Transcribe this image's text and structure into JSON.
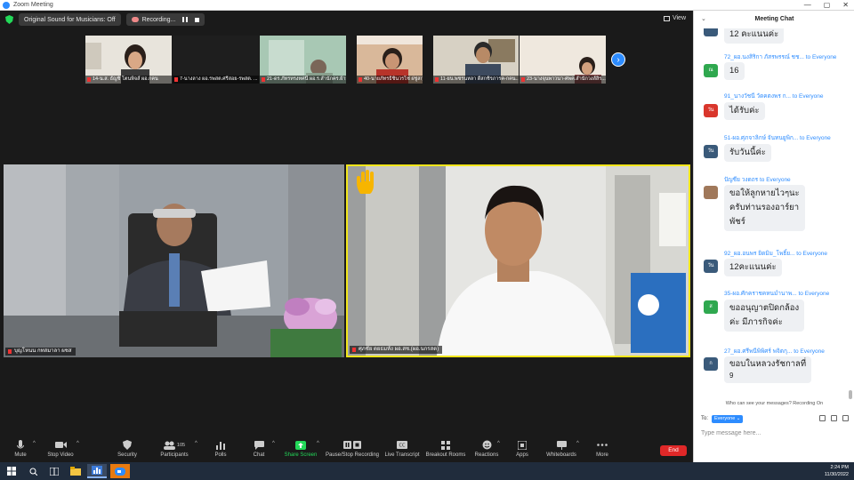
{
  "window": {
    "title": "Zoom Meeting",
    "controls": [
      "—",
      "▢",
      "✕"
    ]
  },
  "topbar": {
    "original_sound": "Original Sound for Musicians: Off",
    "recording": "Recording...",
    "view": "View"
  },
  "thumbnails": [
    {
      "label": "14-น.ส. ธัญชิ โตนพิจส์ ผอ.กคน"
    },
    {
      "label": "7-นางลาง ผอ.รพสต.ศรีสอย-รพสต. ..."
    },
    {
      "label": "21-ดร.ภัทรทรงทศนี้ ผอ.ร.สำนักคร.ฝ้าย..."
    },
    {
      "label": "40-นายภัทรธิชินวรโซ่ ฝชู่สกุลชุธ..."
    },
    {
      "label": "11-ยน.พชรนหลา ดีสกชิรภารค-กคน..."
    },
    {
      "label": "23-นางจุนพาวนา-ศพค.สำนักวงส์สิร..."
    }
  ],
  "main_tiles": [
    {
      "label": "บุญโหนน กทสมาลา ผชส"
    },
    {
      "label": "ศุภชัย ตยธมหัง ผอ.สช.(ผอ.นกรสด)"
    }
  ],
  "toolbar": {
    "mute": "Mute",
    "stop_video": "Stop Video",
    "security": "Security",
    "participants": "Participants",
    "participants_count": "105",
    "polls": "Polls",
    "chat": "Chat",
    "share_screen": "Share Screen",
    "pause_recording": "Pause/Stop Recording",
    "live_transcript": "Live Transcript",
    "breakout_rooms": "Breakout Rooms",
    "reactions": "Reactions",
    "apps": "Apps",
    "whiteboards": "Whiteboards",
    "more": "More",
    "end": "End"
  },
  "chat": {
    "title": "Meeting Chat",
    "messages": [
      {
        "sender": "",
        "to": "",
        "avatar": "",
        "avatar_color": "#3a5a7a",
        "lines": [
          "12 คะแนนค่ะ"
        ]
      },
      {
        "sender": "72_ผอ.นงสิริกา ภัสรพรรณ์ ชช...",
        "to": "to Everyone",
        "avatar": "ณ",
        "avatar_color": "#2fa84f",
        "lines": [
          "16"
        ]
      },
      {
        "sender": "91_นางวัชนี วัดคตงพร ก...",
        "to": "to Everyone",
        "avatar": "วัน",
        "avatar_color": "#d9362c",
        "lines": [
          "ได้รับค่ะ"
        ]
      },
      {
        "sender": "51-ผอ.ศุภจาลิกษ์ จันทนยูพิก...",
        "to": "to Everyone",
        "avatar": "วัน",
        "avatar_color": "#3a5a7a",
        "lines": [
          "รับวันนี้ค่ะ"
        ]
      },
      {
        "sender": "ปัญชีย วงดถร",
        "to": "to Everyone",
        "avatar": "",
        "avatar_color": "#a0785a",
        "lines": [
          "ขอให้ลูกหายไวๆนะ",
          "ครับท่านรองอาร์ยา",
          "พัชร์"
        ]
      },
      {
        "sender": "92_ผอ.อนพร ยิดมิม_โพธิ์ย...",
        "to": "to Everyone",
        "avatar": "วัน",
        "avatar_color": "#3a5a7a",
        "lines": [
          "12คะแนนค่ะ"
        ]
      },
      {
        "sender": "35-ผอ.ศักคราชคหนมำนาพ...",
        "to": "to Everyone",
        "avatar": "ส",
        "avatar_color": "#2fa84f",
        "lines": [
          "ขออนุญาตปิดกล้อง",
          "ค่ะ มีภารกิจค่ะ"
        ]
      },
      {
        "sender": "27_ผอ.ศรีพนีพิพิศร์ พจิตกุ...",
        "to": "to Everyone",
        "avatar": "ก",
        "avatar_color": "#3a5a7a",
        "lines": [
          "ขอบในหลวงรัชกาลที่",
          "9"
        ]
      }
    ],
    "who_can_see": "Who can see your messages? Recording On",
    "to_label": "To:",
    "to_value": "Everyone",
    "input_placeholder": "Type message here..."
  },
  "taskbar": {
    "time": "2:24 PM",
    "date": "11/30/2022"
  },
  "colors": {
    "accent": "#2d8cff",
    "active_speaker": "#f2e61a",
    "end": "#e02828",
    "share": "#23d959"
  }
}
